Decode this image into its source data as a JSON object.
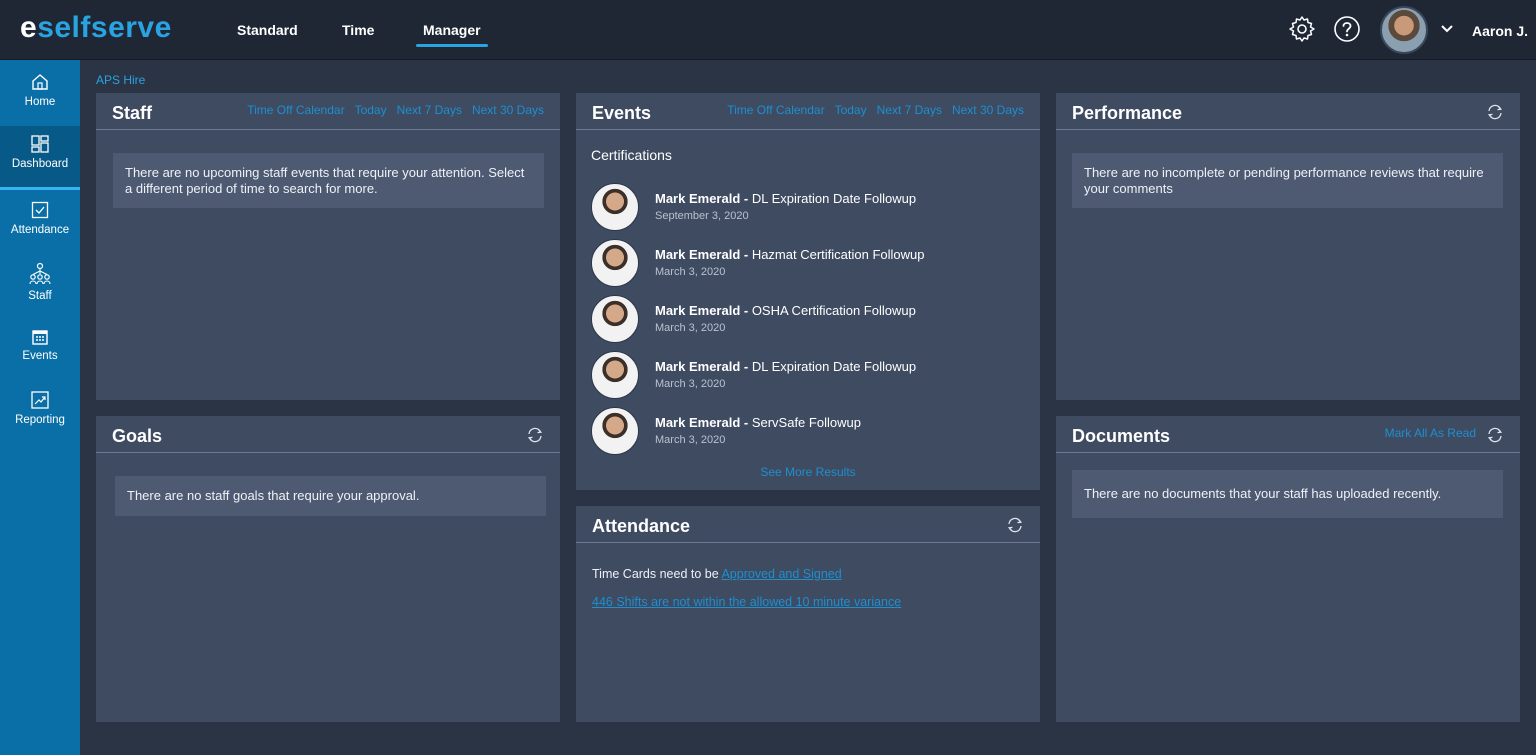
{
  "app": {
    "logo_e": "e",
    "logo_rest": "selfserve",
    "brand_color": "#29a3e2"
  },
  "topnav": {
    "tabs": [
      {
        "label": "Standard",
        "active": false
      },
      {
        "label": "Time",
        "active": false
      },
      {
        "label": "Manager",
        "active": true
      }
    ],
    "icons": [
      "gear-icon",
      "help-icon",
      "avatar",
      "chevron-down-icon"
    ],
    "user_name": "Aaron J."
  },
  "sidebar": {
    "items": [
      {
        "label": "Home",
        "icon": "home-icon"
      },
      {
        "label": "Dashboard",
        "icon": "dashboard-icon",
        "active": true
      },
      {
        "label": "Attendance",
        "icon": "checkbox-icon"
      },
      {
        "label": "Staff",
        "icon": "org-chart-icon"
      },
      {
        "label": "Events",
        "icon": "calendar-icon"
      },
      {
        "label": "Reporting",
        "icon": "report-icon"
      }
    ]
  },
  "breadcrumb": "APS Hire",
  "staff_panel": {
    "title": "Staff",
    "links": [
      "Time Off Calendar",
      "Today",
      "Next 7 Days",
      "Next 30 Days"
    ],
    "message": "There are no upcoming staff events that require your attention. Select a different period of time to search for more."
  },
  "goals_panel": {
    "title": "Goals",
    "message": "There are no staff goals that require your approval."
  },
  "events_panel": {
    "title": "Events",
    "links": [
      "Time Off Calendar",
      "Today",
      "Next 7 Days",
      "Next 30 Days"
    ],
    "section_title": "Certifications",
    "items": [
      {
        "name": "Mark Emerald -",
        "event": " DL Expiration Date Followup",
        "date": "September 3, 2020"
      },
      {
        "name": "Mark Emerald -",
        "event": " Hazmat Certification Followup",
        "date": "March 3, 2020"
      },
      {
        "name": "Mark Emerald -",
        "event": " OSHA Certification Followup",
        "date": "March 3, 2020"
      },
      {
        "name": "Mark Emerald -",
        "event": " DL Expiration Date Followup",
        "date": "March 3, 2020"
      },
      {
        "name": "Mark Emerald -",
        "event": " ServSafe Followup",
        "date": "March 3, 2020"
      }
    ],
    "see_more": "See More Results"
  },
  "attendance_panel": {
    "title": "Attendance",
    "line1_prefix": "Time Cards need to be ",
    "line1_link": "Approved and Signed",
    "line2_link": "446 Shifts are not within the allowed 10 minute variance"
  },
  "performance_panel": {
    "title": "Performance",
    "message": "There are no incomplete or pending performance reviews that require your comments"
  },
  "documents_panel": {
    "title": "Documents",
    "mark_all": "Mark All As Read",
    "message": "There are no documents that your staff has uploaded recently."
  }
}
